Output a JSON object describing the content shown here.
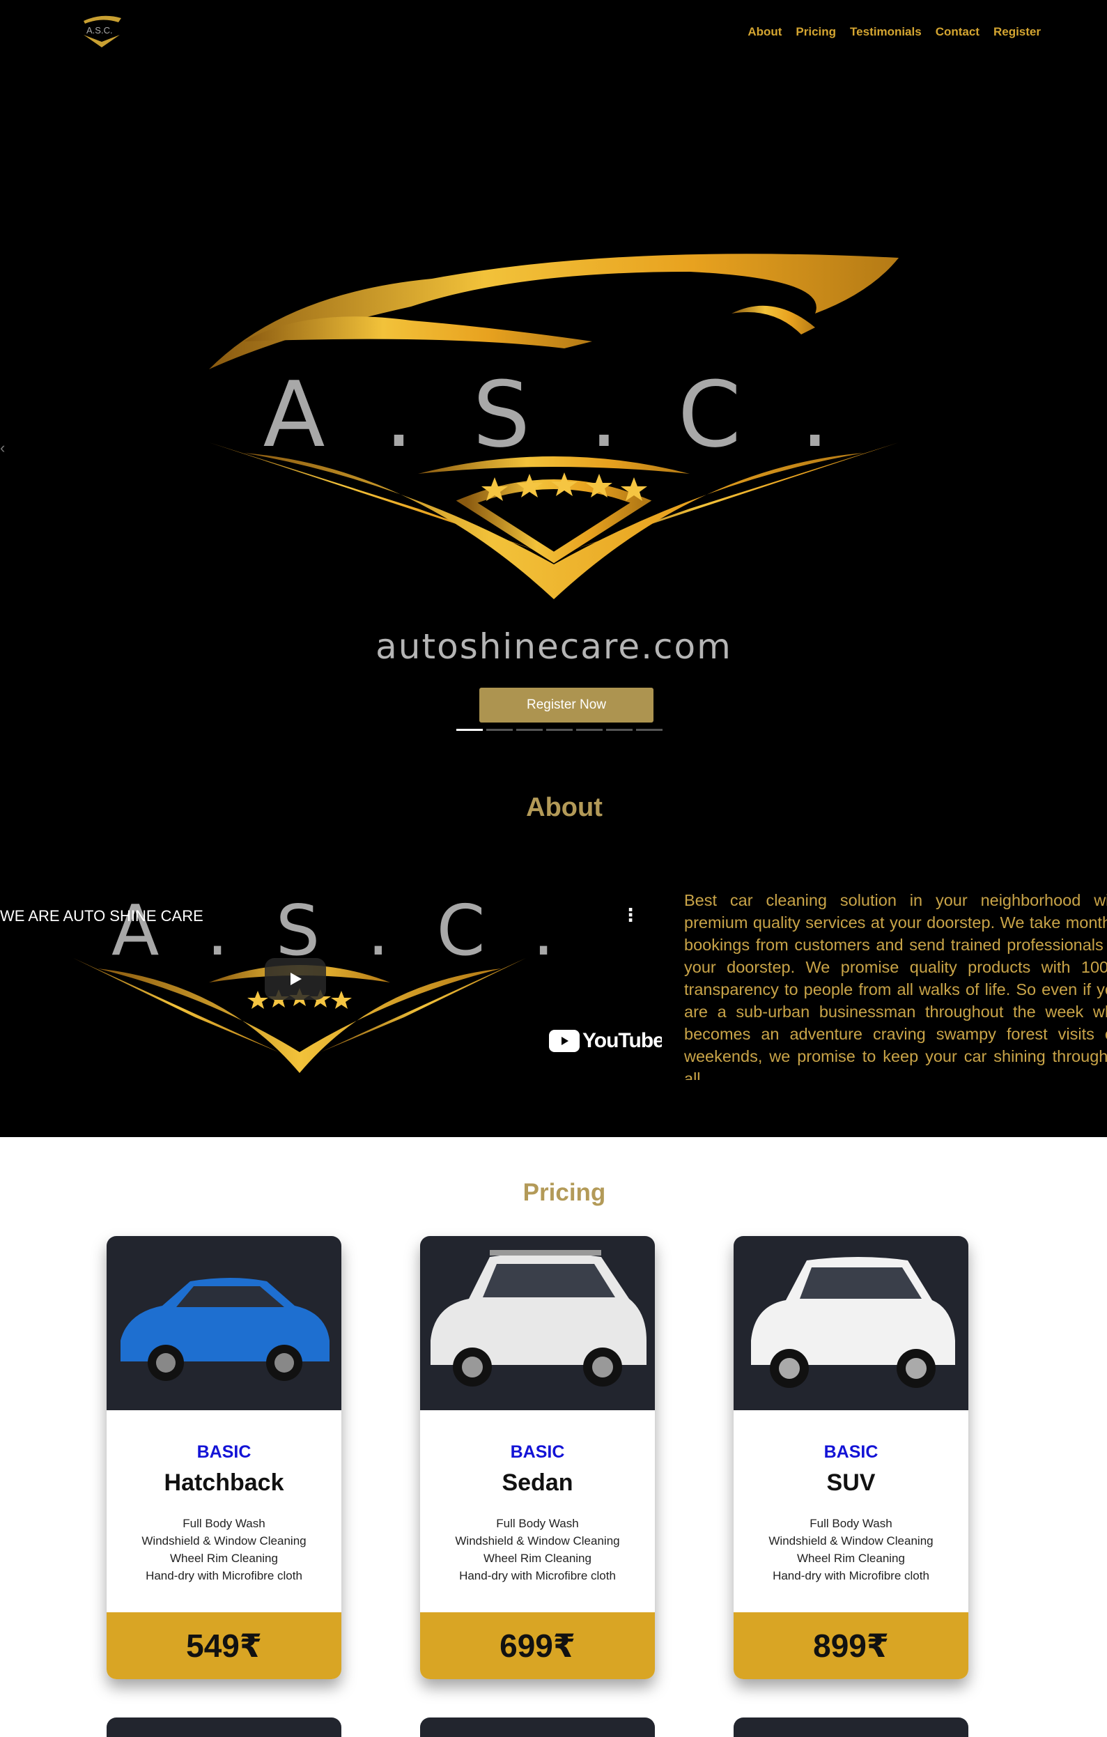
{
  "nav": {
    "logo_icon": "asc-logo",
    "links": [
      "About",
      "Pricing",
      "Testimonials",
      "Contact",
      "Register"
    ]
  },
  "hero": {
    "logo_text": "A . S . C .",
    "domain_text": "autoshinecare.com",
    "register_label": "Register Now",
    "slides_count": 7,
    "active_slide": 1
  },
  "about": {
    "title": "About",
    "video_title": "WE ARE AUTO SHINE CARE",
    "video_brand": "YouTube",
    "text": "Best car cleaning solution in your neighborhood with premium quality services at your doorstep. We take monthly bookings from customers and send trained professionals at your doorstep. We promise quality products with 100% transparency to people from all walks of life. So even if you are a sub-urban businessman throughout the week who becomes an adventure craving swampy forest visits on weekends, we promise to keep your car shining through it all."
  },
  "pricing": {
    "title": "Pricing",
    "plans": [
      {
        "tier": "BASIC",
        "name": "Hatchback",
        "features": [
          "Full Body Wash",
          "Windshield & Window Cleaning",
          "Wheel Rim Cleaning",
          "Hand-dry with Microfibre cloth"
        ],
        "price": "549₹",
        "car_color": "#1e6fd0"
      },
      {
        "tier": "BASIC",
        "name": "Sedan",
        "features": [
          "Full Body Wash",
          "Windshield & Window Cleaning",
          "Wheel Rim Cleaning",
          "Hand-dry with Microfibre cloth"
        ],
        "price": "699₹",
        "car_color": "#e8e8e8"
      },
      {
        "tier": "BASIC",
        "name": "SUV",
        "features": [
          "Full Body Wash",
          "Windshield & Window Cleaning",
          "Wheel Rim Cleaning",
          "Hand-dry with Microfibre cloth"
        ],
        "price": "899₹",
        "car_color": "#f2f2f2"
      }
    ]
  },
  "colors": {
    "gold": "#d4a531",
    "button": "#ad9450",
    "price_band": "#d9a524",
    "tier_blue": "#1313d6"
  }
}
